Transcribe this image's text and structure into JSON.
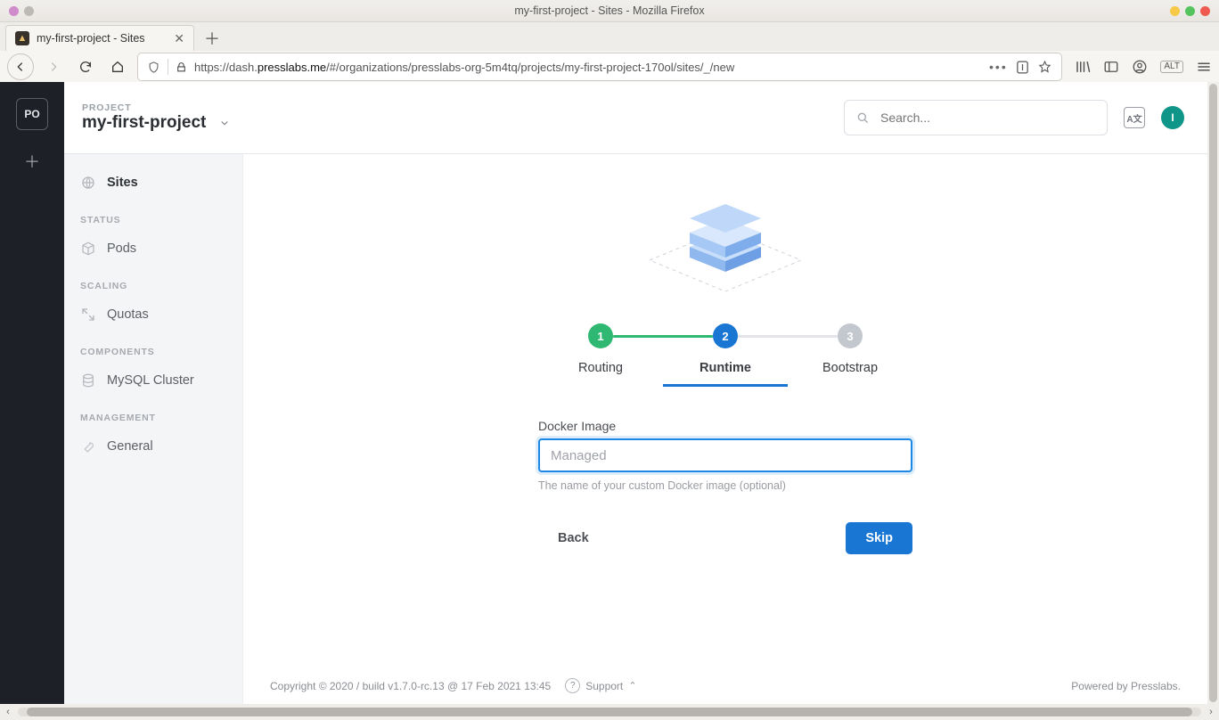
{
  "window": {
    "title": "my-first-project - Sites - Mozilla Firefox"
  },
  "tab": {
    "title": "my-first-project - Sites"
  },
  "url": {
    "scheme": "https://",
    "prefix": "dash.",
    "host": "presslabs.me",
    "path": "/#/organizations/presslabs-org-5m4tq/projects/my-first-project-170ol/sites/_/new"
  },
  "rail": {
    "org_initials": "PO"
  },
  "header": {
    "project_label": "PROJECT",
    "project_name": "my-first-project",
    "search_placeholder": "Search...",
    "lang_label": "A文",
    "avatar_initial": "I"
  },
  "sidenav": {
    "groups": [
      {
        "title": null,
        "items": [
          {
            "label": "Sites",
            "active": true
          }
        ]
      },
      {
        "title": "STATUS",
        "items": [
          {
            "label": "Pods",
            "active": false
          }
        ]
      },
      {
        "title": "SCALING",
        "items": [
          {
            "label": "Quotas",
            "active": false
          }
        ]
      },
      {
        "title": "COMPONENTS",
        "items": [
          {
            "label": "MySQL Cluster",
            "active": false
          }
        ]
      },
      {
        "title": "MANAGEMENT",
        "items": [
          {
            "label": "General",
            "active": false
          }
        ]
      }
    ]
  },
  "wizard": {
    "steps": [
      {
        "num": "1",
        "label": "Routing",
        "state": "done"
      },
      {
        "num": "2",
        "label": "Runtime",
        "state": "current"
      },
      {
        "num": "3",
        "label": "Bootstrap",
        "state": "pending"
      }
    ],
    "field_label": "Docker Image",
    "field_placeholder": "Managed",
    "field_value": "",
    "field_help": "The name of your custom Docker image (optional)",
    "back_label": "Back",
    "skip_label": "Skip"
  },
  "footer": {
    "copyright": "Copyright © 2020 / build v1.7.0-rc.13 @ 17 Feb 2021 13:45",
    "support": "Support",
    "powered": "Powered by Presslabs."
  }
}
